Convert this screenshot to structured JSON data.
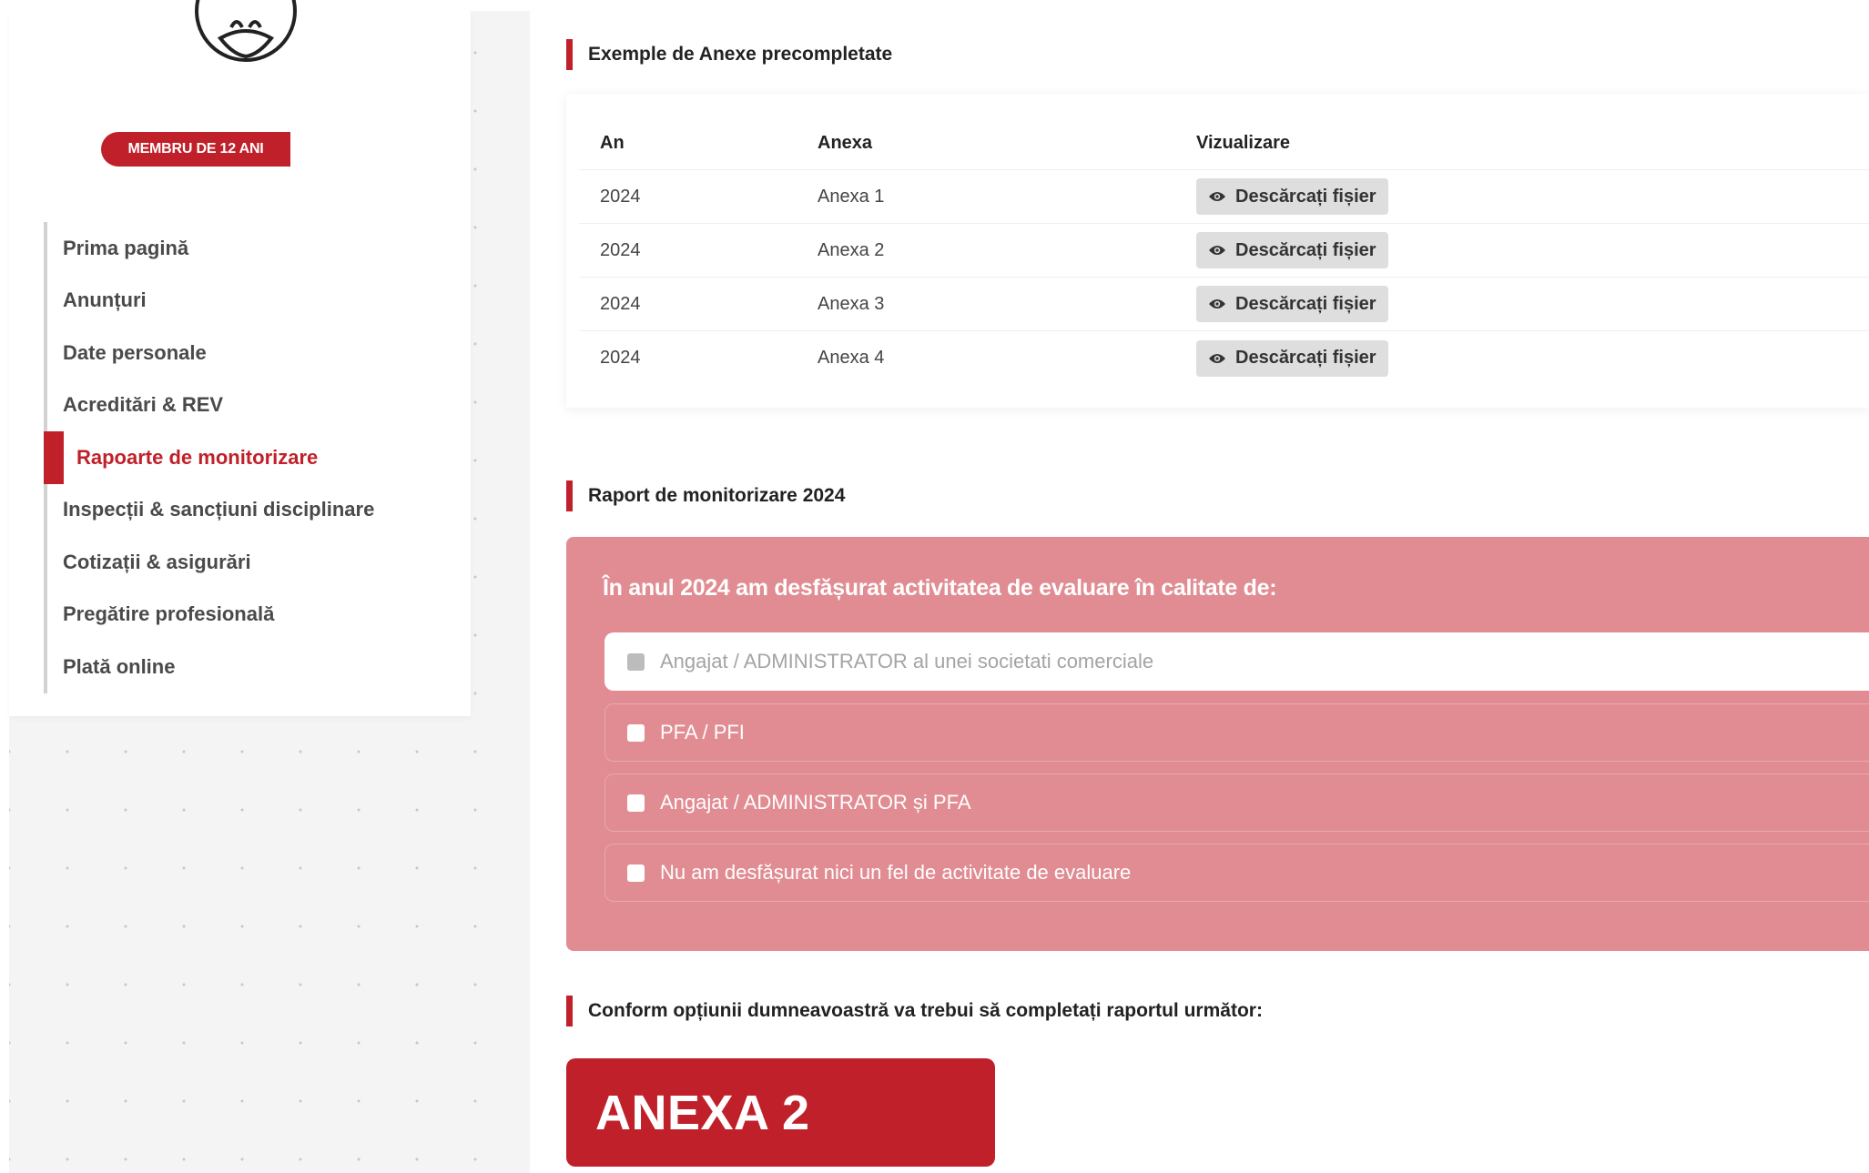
{
  "sidebar": {
    "member_badge": "MEMBRU DE 12 ANI",
    "items": [
      {
        "label": "Prima pagină",
        "active": false
      },
      {
        "label": "Anunțuri",
        "active": false
      },
      {
        "label": "Date personale",
        "active": false
      },
      {
        "label": "Acreditări & REV",
        "active": false
      },
      {
        "label": "Rapoarte de monitorizare",
        "active": true
      },
      {
        "label": "Inspecții & sancțiuni disciplinare",
        "active": false
      },
      {
        "label": "Cotizații & asigurări",
        "active": false
      },
      {
        "label": "Pregătire profesională",
        "active": false
      },
      {
        "label": "Plată online",
        "active": false
      }
    ]
  },
  "annex_section": {
    "title": "Exemple de Anexe precompletate",
    "columns": [
      "An",
      "Anexa",
      "Vizualizare"
    ],
    "rows": [
      {
        "an": "2024",
        "anexa": "Anexa 1",
        "button": "Descărcați fișier"
      },
      {
        "an": "2024",
        "anexa": "Anexa 2",
        "button": "Descărcați fișier"
      },
      {
        "an": "2024",
        "anexa": "Anexa 3",
        "button": "Descărcați fișier"
      },
      {
        "an": "2024",
        "anexa": "Anexa 4",
        "button": "Descărcați fișier"
      }
    ]
  },
  "report_section": {
    "title": "Raport de monitorizare 2024",
    "question": "În anul 2024 am desfășurat activitatea de evaluare în calitate de:",
    "options": [
      {
        "label": "Angajat / ADMINISTRATOR al unei societati comerciale",
        "selected": true
      },
      {
        "label": "PFA / PFI",
        "selected": false
      },
      {
        "label": "Angajat / ADMINISTRATOR și PFA",
        "selected": false
      },
      {
        "label": "Nu am desfășurat nici un fel de activitate de evaluare",
        "selected": false
      }
    ]
  },
  "result_section": {
    "title": "Conform opțiunii dumneavoastră va trebui să completați raportul următor:",
    "button": "ANEXA 2"
  },
  "colors": {
    "accent": "#c0202a",
    "panel": "#e08c92",
    "button_gray": "#dedede"
  },
  "icons": {
    "avatar": "user-avatar-icon",
    "download": "eye-icon",
    "checkbox": "checkbox-icon"
  }
}
